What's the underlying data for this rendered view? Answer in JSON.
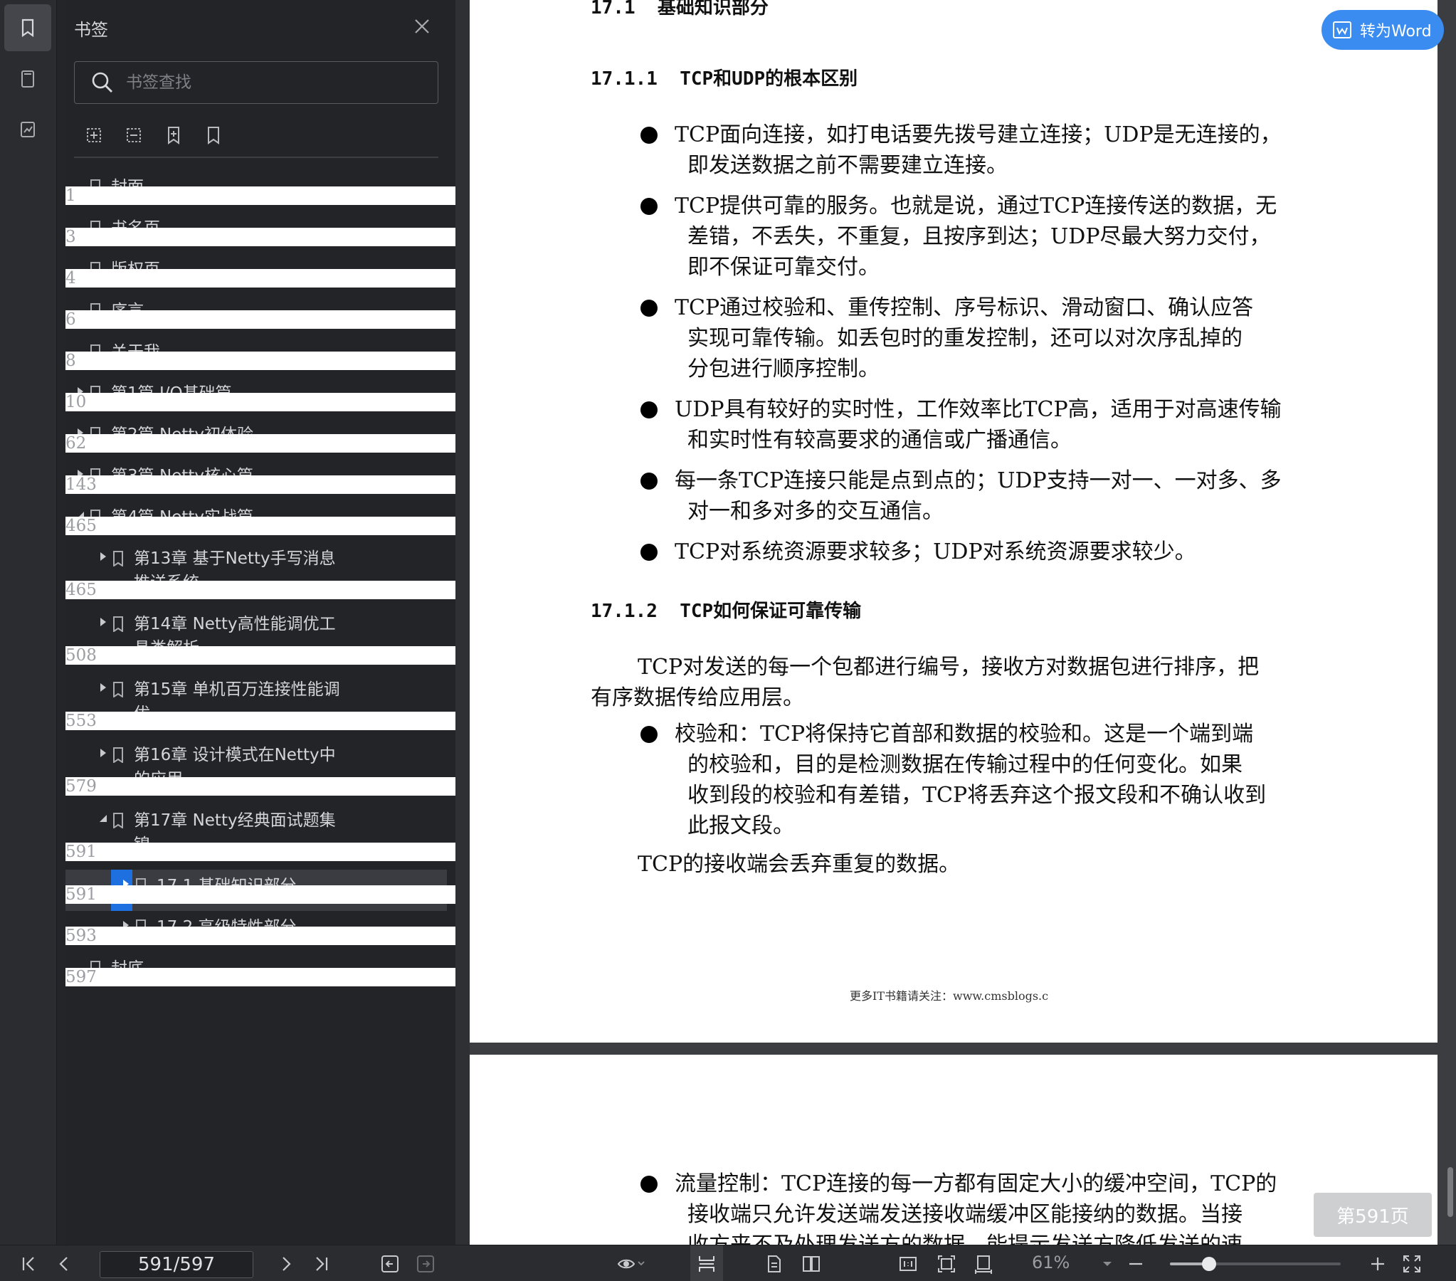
{
  "sidebar_panel": {
    "title": "书签",
    "search_placeholder": "书签查找",
    "items": [
      {
        "label": "封面",
        "page": "1",
        "level": 0,
        "expand": "none"
      },
      {
        "label": "书名页",
        "page": "3",
        "level": 0,
        "expand": "none"
      },
      {
        "label": "版权页",
        "page": "4",
        "level": 0,
        "expand": "none"
      },
      {
        "label": "序言",
        "page": "6",
        "level": 0,
        "expand": "none"
      },
      {
        "label": "关于我",
        "page": "8",
        "level": 0,
        "expand": "none"
      },
      {
        "label": "第1篇 I/O基础篇",
        "page": "10",
        "level": 0,
        "expand": "collapsed"
      },
      {
        "label": "第2篇 Netty初体验",
        "page": "62",
        "level": 0,
        "expand": "collapsed"
      },
      {
        "label": "第3篇 Netty核心篇",
        "page": "143",
        "level": 0,
        "expand": "collapsed"
      },
      {
        "label": "第4篇 Netty实战篇",
        "page": "465",
        "level": 0,
        "expand": "expanded"
      },
      {
        "label": "第13章 基于Netty手写消息",
        "label2": "推送系统",
        "page": "465",
        "level": 1,
        "expand": "collapsed"
      },
      {
        "label": "第14章 Netty高性能调优工",
        "label2": "具类解析",
        "page": "508",
        "level": 1,
        "expand": "collapsed"
      },
      {
        "label": "第15章 单机百万连接性能调",
        "label2": "优",
        "page": "553",
        "level": 1,
        "expand": "collapsed"
      },
      {
        "label": "第16章 设计模式在Netty中",
        "label2": "的应用",
        "page": "579",
        "level": 1,
        "expand": "collapsed"
      },
      {
        "label": "第17章 Netty经典面试题集",
        "label2": "锦",
        "page": "591",
        "level": 1,
        "expand": "expanded"
      },
      {
        "label": "17.1 基础知识部分",
        "page": "591",
        "level": 2,
        "expand": "collapsed",
        "selected": true
      },
      {
        "label": "17.2 高级特性部分",
        "page": "593",
        "level": 2,
        "expand": "collapsed"
      },
      {
        "label": "封底",
        "page": "597",
        "level": 0,
        "expand": "none"
      }
    ]
  },
  "document": {
    "section_title": "17.1  基础知识部分",
    "h1": "17.1.1  TCP和UDP的根本区别",
    "bullets1": [
      [
        "TCP面向连接，如打电话要先拨号建立连接；UDP是无连接的，",
        "即发送数据之前不需要建立连接。"
      ],
      [
        "TCP提供可靠的服务。也就是说，通过TCP连接传送的数据，无",
        "差错，不丢失，不重复，且按序到达；UDP尽最大努力交付，",
        "即不保证可靠交付。"
      ],
      [
        "TCP通过校验和、重传控制、序号标识、滑动窗口、确认应答",
        "实现可靠传输。如丢包时的重发控制，还可以对次序乱掉的",
        "分包进行顺序控制。"
      ],
      [
        "UDP具有较好的实时性，工作效率比TCP高，适用于对高速传输",
        "和实时性有较高要求的通信或广播通信。"
      ],
      [
        "每一条TCP连接只能是点到点的；UDP支持一对一、一对多、多",
        "对一和多对多的交互通信。"
      ],
      [
        "TCP对系统资源要求较多；UDP对系统资源要求较少。"
      ]
    ],
    "h2": "17.1.2  TCP如何保证可靠传输",
    "para1": [
      "TCP对发送的每一个包都进行编号，接收方对数据包进行排序，把",
      "有序数据传给应用层。"
    ],
    "bullet2": [
      "校验和：TCP将保持它首部和数据的校验和。这是一个端到端",
      "的校验和，目的是检测数据在传输过程中的任何变化。如果",
      "收到段的校验和有差错，TCP将丢弃这个报文段和不确认收到",
      "此报文段。"
    ],
    "para2": "TCP的接收端会丢弃重复的数据。",
    "footer": "更多IT书籍请关注：www.cmsblogs.c",
    "page2_bullet": [
      "流量控制：TCP连接的每一方都有固定大小的缓冲空间，TCP的",
      "接收端只允许发送端发送接收端缓冲区能接纳的数据。当接",
      "收方来不及处理发送方的数据，能提示发送方降低发送的速"
    ]
  },
  "to_word_label": "转为Word",
  "page_badge": "第591页",
  "bottom_bar": {
    "page_indicator": "591/597",
    "zoom": "61%",
    "zoom_slider_fraction": 0.23
  }
}
